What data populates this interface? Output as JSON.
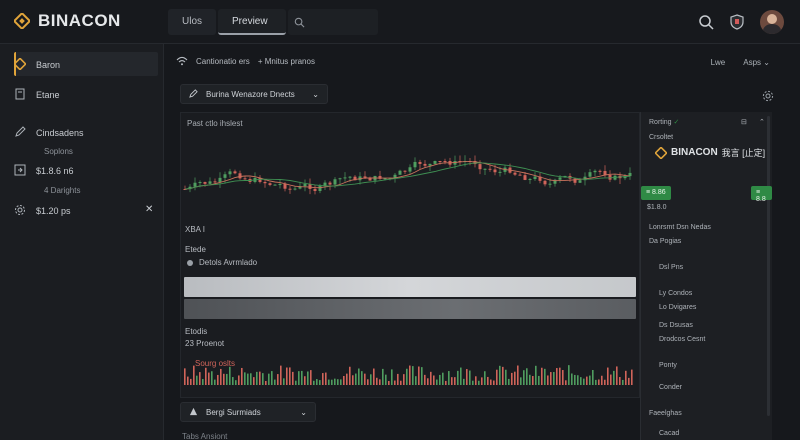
{
  "app": {
    "brand": "BINACON",
    "tabs": [
      {
        "label": "Ulos"
      },
      {
        "label": "Preview"
      }
    ]
  },
  "sidebar": {
    "items": [
      {
        "label": "Baron"
      },
      {
        "label": "Etane"
      },
      {
        "label": "Cindsadens"
      },
      {
        "label": "$1.8.6 n6"
      },
      {
        "label": "$1.20 ps"
      }
    ],
    "subs": [
      "Soplons",
      "4 Darights"
    ]
  },
  "main": {
    "connection": "Cantionatio ers",
    "connection_extra": "+ Mnitus pranos",
    "ctrl_left": "Lwe",
    "ctrl_right": "Asps",
    "dropdown": "Burina Wenazore Dnects",
    "panel_title": "Past ctlo ihslest",
    "legend_label": "XBA I",
    "sec1_title": "Etede",
    "sec1_sub": "Detols Avrmlado",
    "sec2_title": "Etodis",
    "sec2_sub": "23 Proenot",
    "sec3_label": "Sourg oslts",
    "bottom_dropdown": "Bergi Surmiads",
    "bottom_cut": "Tabs Ansiont"
  },
  "right_panel": {
    "title": "Rorting",
    "subtitle": "Crsoltet",
    "brand": "BINACON",
    "brand_suffix": "我言 [止定]",
    "badge_left": "≡ 8.86",
    "badge_right": "≡ 8.8",
    "value": "$1.8.0",
    "items": [
      "Lonrsmt Dsn Nedas",
      "Da Pogias",
      "Dsl Pns",
      "Ly Condos",
      "Lo Dvigares",
      "Ds Dsusas",
      "Drodcos Cesnt",
      "Ponty",
      "Conder",
      "Faeelghas",
      "Cacad"
    ]
  },
  "colors": {
    "accent": "#e0a43a",
    "up": "#4f9d5f",
    "down": "#d0645a",
    "badge": "#2f8a45"
  }
}
